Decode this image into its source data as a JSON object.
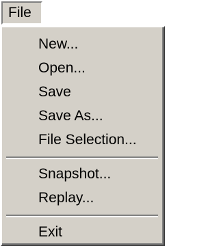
{
  "menubar": {
    "file_label": "File"
  },
  "menu": {
    "items": [
      {
        "label": "New..."
      },
      {
        "label": "Open..."
      },
      {
        "label": "Save"
      },
      {
        "label": "Save As..."
      },
      {
        "label": "File Selection..."
      },
      {
        "label": "Snapshot..."
      },
      {
        "label": "Replay..."
      },
      {
        "label": "Exit"
      }
    ]
  },
  "colors": {
    "menu_face": "#d4d0c8",
    "shadow": "#808080",
    "highlight": "#ffffff",
    "text": "#000000"
  }
}
